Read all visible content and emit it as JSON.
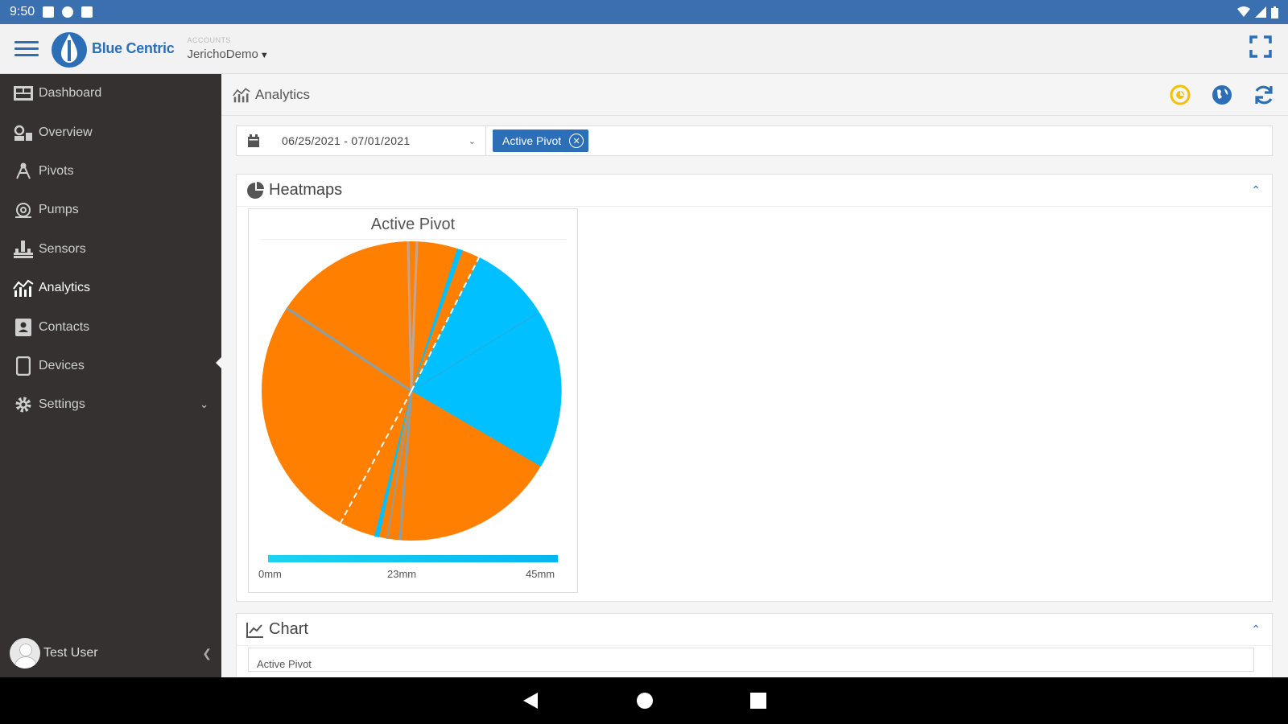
{
  "status": {
    "time": "9:50"
  },
  "header": {
    "brand": "Blue Centric",
    "account_label": "ACCOUNTS",
    "account_name": "JerichoDemo"
  },
  "sidebar": {
    "items": [
      {
        "label": "Dashboard",
        "icon": "dashboard-icon"
      },
      {
        "label": "Overview",
        "icon": "overview-icon"
      },
      {
        "label": "Pivots",
        "icon": "pivot-icon"
      },
      {
        "label": "Pumps",
        "icon": "pump-icon"
      },
      {
        "label": "Sensors",
        "icon": "sensor-icon"
      },
      {
        "label": "Analytics",
        "icon": "analytics-icon",
        "active": true
      },
      {
        "label": "Contacts",
        "icon": "contacts-icon"
      },
      {
        "label": "Devices",
        "icon": "device-icon"
      },
      {
        "label": "Settings",
        "icon": "gear-icon",
        "expandable": true
      }
    ],
    "user_name": "Test User"
  },
  "page": {
    "title": "Analytics",
    "date_range": "06/25/2021 - 07/01/2021",
    "filter_tag": "Active Pivot"
  },
  "heatmaps": {
    "section_title": "Heatmaps",
    "panel_title": "Active Pivot",
    "legend": {
      "min": "0mm",
      "mid": "23mm",
      "max": "45mm"
    }
  },
  "chart_section": {
    "section_title": "Chart",
    "selector": "Active Pivot"
  },
  "colors": {
    "brand": "#2d6fb6",
    "sidebar": "#343130",
    "heat_low": "#ff8000",
    "heat_high": "#00c0ff"
  }
}
